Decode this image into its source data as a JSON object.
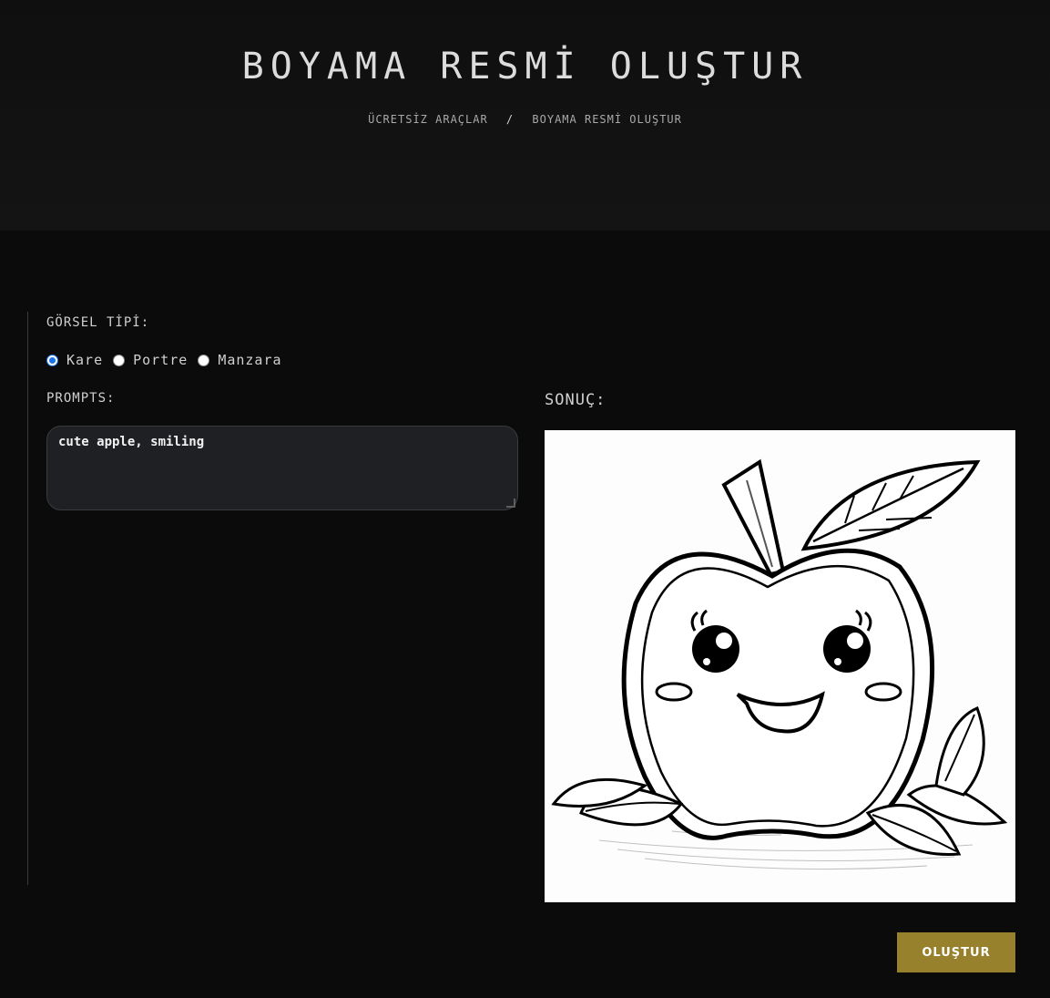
{
  "header": {
    "title": "BOYAMA RESMİ OLUŞTUR",
    "breadcrumb": {
      "home": "ÜCRETSİZ ARAÇLAR",
      "separator": "/",
      "current": "BOYAMA RESMİ OLUŞTUR"
    }
  },
  "form": {
    "image_type_label": "GÖRSEL TİPİ:",
    "image_type_options": [
      {
        "label": "Kare",
        "selected": true
      },
      {
        "label": "Portre",
        "selected": false
      },
      {
        "label": "Manzara",
        "selected": false
      }
    ],
    "prompts_label": "PROMPTS:",
    "prompt_value": "cute apple, smiling"
  },
  "result": {
    "label": "SONUÇ:",
    "image_icon": "apple-coloring-page"
  },
  "actions": {
    "submit_label": "OLUŞTUR"
  },
  "colors": {
    "background": "#0b0b0b",
    "accent": "#98812c",
    "radio_selected": "#1a73e8"
  }
}
